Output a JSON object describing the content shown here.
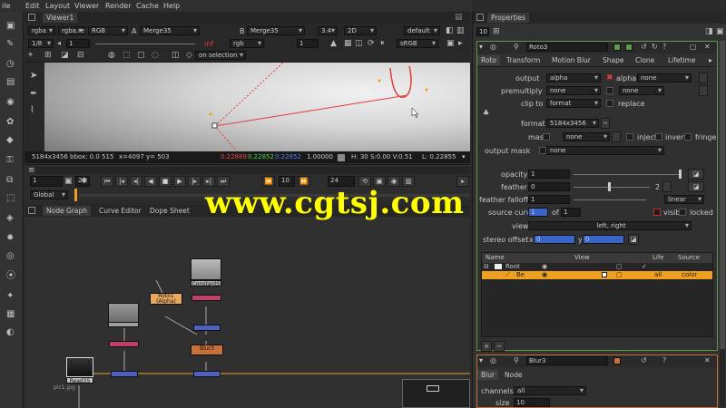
{
  "menu": {
    "items": [
      "ile",
      "Edit",
      "Layout",
      "Viewer",
      "Render",
      "Cache",
      "Help"
    ]
  },
  "viewer": {
    "tab_label": "Viewer1",
    "controls_row1": {
      "layer1": "rgba",
      "layer2": "rgba.red",
      "channel": "RGB",
      "input_a_label": "A",
      "input_a": "Merge35",
      "input_b_label": "B",
      "input_b": "Merge35",
      "ratio": "3.4",
      "mode": "2D",
      "lut": "default"
    },
    "controls_row2": {
      "proxy": "1/8",
      "frame_field": "1",
      "gain_icon_label": "f/8",
      "inf_label": "inf",
      "gamma_label": "rgb",
      "y_label": "Y",
      "gamma_value": "1",
      "colorspace": "sRGB"
    },
    "controls_row3": {
      "on_selection": "on selection"
    },
    "info_bar": {
      "format": "5184x3456",
      "bbox": "bbox: 0.0 515",
      "x": "x=4097",
      "y": "y= 503",
      "r": "0.22889",
      "g": "0.22852",
      "b": "0.22852",
      "a": "1.00000",
      "hsv": "H: 30 S:0.00 V:0.51",
      "l": "L: 0.22855"
    }
  },
  "timeline": {
    "frame_value": "1",
    "fps": "24",
    "step": "10",
    "frame_icon": "▣",
    "global_label": "Global",
    "current_frame": "1"
  },
  "nodegraph": {
    "tabs": [
      "Node Graph",
      "Curve Editor",
      "Dope Sheet"
    ],
    "nodes": [
      {
        "name": "Constant5",
        "kind": "thumb"
      },
      {
        "name": "Roto1\n(Alpha)",
        "kind": "roto"
      },
      {
        "name": "Blur3",
        "kind": "blur"
      },
      {
        "name": "Read35",
        "kind": "read"
      },
      {
        "name": "pic1.jpg",
        "kind": "readlabel"
      }
    ]
  },
  "properties": {
    "title": "Properties",
    "max_panels": "10",
    "node_name": "Roto3",
    "tabs": [
      "Roto",
      "Transform",
      "Motion Blur",
      "Shape",
      "Clone",
      "Lifetime"
    ],
    "output_label": "output",
    "output_value": "alpha",
    "output_check_label": "alpha",
    "output_second": "none",
    "premultiply_label": "premultiply",
    "premultiply_value": "none",
    "premultiply_second": "none",
    "clip_label": "clip to",
    "clip_value": "format",
    "replace_label": "replace",
    "format_label": "format",
    "format_value": "5184x3456",
    "mask_label": "mask",
    "mask_value": "none",
    "inject_label": "inject",
    "invert_label": "invert",
    "fringe_label": "fringe",
    "output_mask_label": "output mask",
    "output_mask_value": "none",
    "opacity_label": "opacity",
    "opacity_value": "1",
    "feather_label": "feather",
    "feather_value": "0",
    "feather_falloff_label": "feather falloff",
    "feather_falloff_value": "1",
    "falloff_type": "linear",
    "source_curve_label": "source curve",
    "source_curve_value": "1",
    "of_label": "of",
    "of_value": "1",
    "visible_label": "visible",
    "locked_label": "locked",
    "view_label": "view",
    "view_value": "left, right",
    "stereo_label": "stereo offset",
    "stereo_x_label": "x",
    "stereo_x": "0",
    "stereo_y_label": "y",
    "stereo_y": "0",
    "list_headers": [
      "Name",
      "",
      "",
      "View",
      "",
      "",
      "",
      "",
      "Life",
      "Source"
    ],
    "list_root": "Root",
    "list_item_name": "Be",
    "list_item_life": "all",
    "list_item_source": "color",
    "add_btn": "+",
    "remove_btn": "−",
    "panel2_name": "Blur3",
    "panel2_tabs": [
      "Blur",
      "Node"
    ],
    "channels_label": "channels",
    "channels_value": "all",
    "size_label": "size",
    "size_value": "10"
  },
  "watermark": "www.cgtsj.com",
  "colors": {
    "accent_orange": "#f0a020",
    "selection_blue": "#3a64c8",
    "roto_node": "#e8a860",
    "blur_node": "#c87038",
    "merge_node": "#5060c0",
    "watermark": "#ffff00"
  }
}
